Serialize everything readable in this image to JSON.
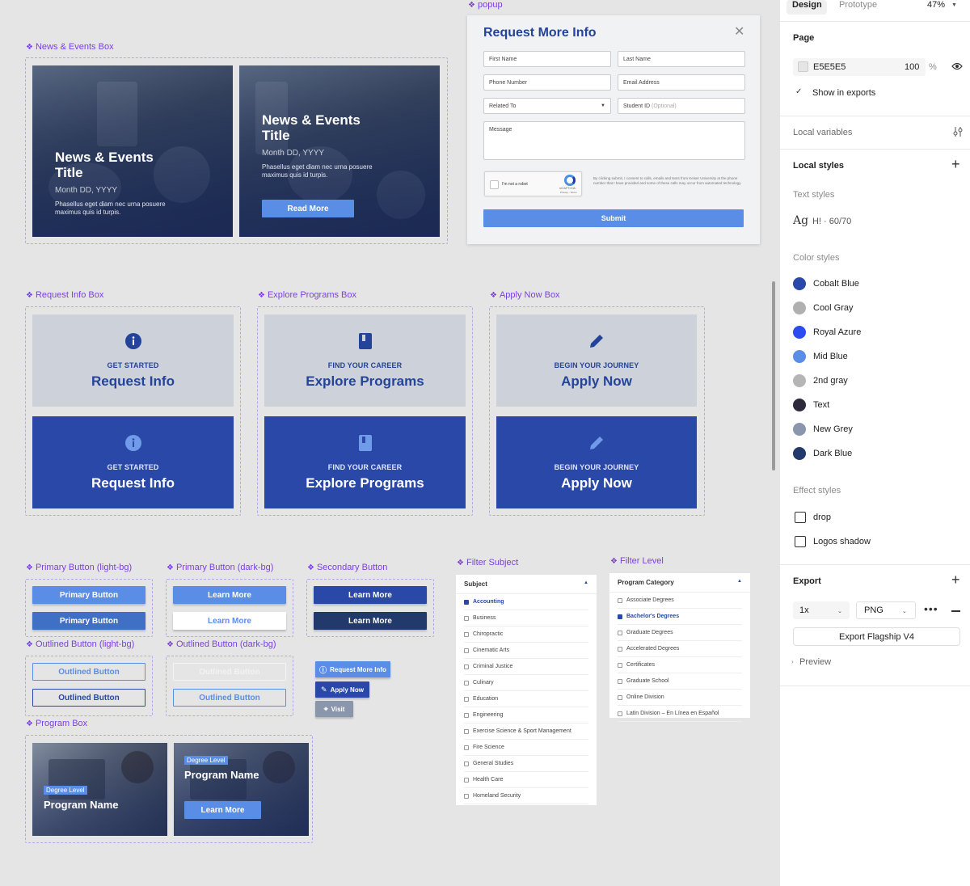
{
  "canvas": {
    "labels": {
      "news_events_box": "News & Events Box",
      "popup": "popup",
      "request_info_box": "Request Info Box",
      "explore_programs_box": "Explore Programs Box",
      "apply_now_box": "Apply Now Box",
      "primary_button_light": "Primary Button (light-bg)",
      "primary_button_dark": "Primary Button (dark-bg)",
      "secondary_button": "Secondary Button",
      "outlined_button_light": "Outlined Button (light-bg)",
      "outlined_button_dark": "Outlined Button (dark-bg)",
      "program_box": "Program Box",
      "filter_subject": "Filter Subject",
      "filter_level": "Filter Level"
    },
    "news": {
      "card1": {
        "title": "News & Events Title",
        "date": "Month DD, YYYY",
        "desc": "Phasellus eget diam nec urna posuere maximus quis id turpis."
      },
      "card2": {
        "title": "News & Events Title",
        "date": "Month DD, YYYY",
        "desc": "Phasellus eget diam nec urna posuere maximus quis id turpis.",
        "button": "Read More"
      }
    },
    "popup": {
      "title": "Request More Info",
      "first_name": "First Name",
      "last_name": "Last Name",
      "phone": "Phone Number",
      "email": "Email Address",
      "related_to": "Related To",
      "student_id": "Student ID",
      "student_id_optional": "(Optional)",
      "message": "Message",
      "captcha": "I'm not a robot",
      "captcha_brand": "reCAPTCHA",
      "captcha_terms": "Privacy - Terms",
      "consent": "By clicking submit, I consent to calls, emails and texts from Keiser University at the phone number that I have provided and some of these calls may occur from automated technology.",
      "submit": "Submit"
    },
    "tiles": {
      "request": {
        "kicker": "GET STARTED",
        "title": "Request Info"
      },
      "explore": {
        "kicker": "FIND YOUR CAREER",
        "title": "Explore Programs"
      },
      "apply": {
        "kicker": "BEGIN YOUR JOURNEY",
        "title": "Apply Now"
      }
    },
    "buttons": {
      "primary_button": "Primary Button",
      "learn_more": "Learn More",
      "outlined_button": "Outlined Button",
      "request_more_info": "Request More Info",
      "apply_now": "Apply Now",
      "visit": "Visit"
    },
    "program": {
      "degree_level": "Degree Level",
      "program_name": "Program Name",
      "learn_more": "Learn More"
    },
    "filter_subject": {
      "header": "Subject",
      "items": [
        "Accounting",
        "Business",
        "Chiropractic",
        "Cinematic Arts",
        "Criminal Justice",
        "Culinary",
        "Education",
        "Engineering",
        "Exercise Science & Sport Management",
        "Fire Science",
        "General Studies",
        "Health Care",
        "Homeland Security"
      ],
      "checked": "Accounting"
    },
    "filter_level": {
      "header": "Program Category",
      "items": [
        "Associate Degrees",
        "Bachelor's Degrees",
        "Graduate Degrees",
        "Accelerated Degrees",
        "Certificates",
        "Graduate School",
        "Online Division",
        "Latin Division – En Línea en Español"
      ],
      "checked": "Bachelor's Degrees"
    }
  },
  "panel": {
    "tabs": {
      "design": "Design",
      "prototype": "Prototype",
      "zoom": "47%"
    },
    "page": {
      "title": "Page",
      "color": "E5E5E5",
      "opacity": "100",
      "percent": "%",
      "show_in_exports": "Show in exports"
    },
    "local_variables": "Local variables",
    "local_styles": "Local styles",
    "text_styles": {
      "title": "Text styles",
      "sample": "Ag",
      "name": "H! · 60/70"
    },
    "color_styles": {
      "title": "Color styles",
      "items": [
        {
          "name": "Cobalt Blue",
          "color": "#2a48a8"
        },
        {
          "name": "Cool Gray",
          "color": "#b0b0b0"
        },
        {
          "name": "Royal Azure",
          "color": "#2b4cf0"
        },
        {
          "name": "Mid Blue",
          "color": "#5a8ee6"
        },
        {
          "name": "2nd gray",
          "color": "#b5b5b5"
        },
        {
          "name": "Text",
          "color": "#2e2a3c"
        },
        {
          "name": "New Grey",
          "color": "#8a96ab"
        },
        {
          "name": "Dark Blue",
          "color": "#213a6b"
        }
      ]
    },
    "effect_styles": {
      "title": "Effect styles",
      "items": [
        "drop",
        "Logos shadow"
      ]
    },
    "export": {
      "title": "Export",
      "scale": "1x",
      "format": "PNG",
      "button": "Export Flagship V4",
      "preview": "Preview"
    }
  }
}
